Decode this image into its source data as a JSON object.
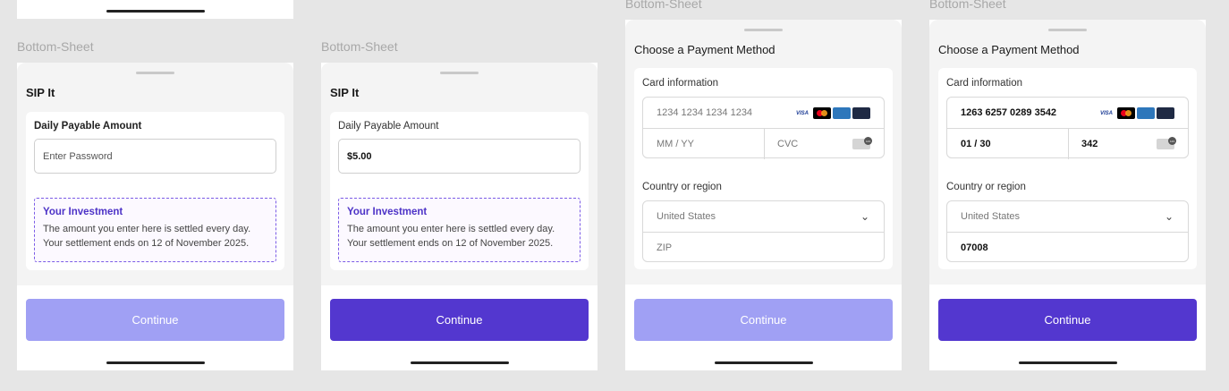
{
  "frame_label": "Bottom-Sheet",
  "sip_sheets": [
    {
      "title": "SIP It",
      "field_label": "Daily Payable Amount",
      "input_value": "",
      "input_placeholder": "Enter Password",
      "info_title": "Your Investment",
      "info_line1": "The amount you enter here is settled every day.",
      "info_line2": "Your settlement ends on 12 of November 2025.",
      "button_label": "Continue",
      "button_state": "disabled"
    },
    {
      "title": "SIP It",
      "field_label": "Daily Payable Amount",
      "input_value": "$5.00",
      "input_placeholder": "",
      "info_title": "Your Investment",
      "info_line1": "The amount you enter here is settled every day.",
      "info_line2": "Your settlement ends on 12 of November 2025.",
      "button_label": "Continue",
      "button_state": "active"
    }
  ],
  "payment_sheets": [
    {
      "title": "Choose a Payment Method",
      "card_label": "Card information",
      "card_number": "1234 1234 1234 1234",
      "expiry": "MM / YY",
      "cvc": "CVC",
      "filled": false,
      "country_label": "Country or region",
      "country_value": "United States",
      "zip": "ZIP",
      "button_label": "Continue",
      "button_state": "disabled"
    },
    {
      "title": "Choose a Payment Method",
      "card_label": "Card information",
      "card_number": "1263 6257 0289 3542",
      "expiry": "01 / 30",
      "cvc": "342",
      "filled": true,
      "country_label": "Country or region",
      "country_value": "United States",
      "zip": "07008",
      "button_label": "Continue",
      "button_state": "active"
    }
  ],
  "card_brands": [
    "VISA",
    "Mastercard",
    "AMERICAN EXPRESS",
    "DISCOVER"
  ],
  "colors": {
    "accent": "#5337cf",
    "accent_disabled": "#a0a0f4",
    "info_title": "#4d33c7",
    "background": "#e6e6e6"
  }
}
